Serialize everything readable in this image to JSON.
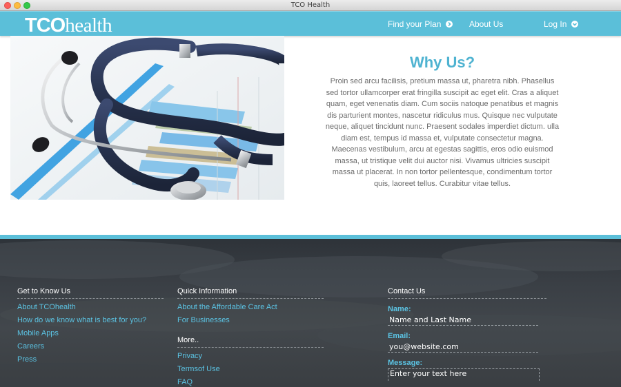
{
  "window": {
    "title": "TCO Health"
  },
  "header": {
    "logo_bold": "TCO",
    "logo_light": "health",
    "nav": {
      "find_plan": "Find your Plan",
      "about": "About Us",
      "login": "Log In"
    },
    "icons": {
      "find_plan": "chevron-right-circle-icon",
      "login": "chevron-down-circle-icon"
    },
    "color": "#5bbfd9"
  },
  "hero": {
    "image": "stethoscope-on-chart-photo"
  },
  "why_us": {
    "title": "Why Us?",
    "body": "Proin sed arcu facilisis, pretium massa ut, pharetra nibh. Phasellus sed tortor ullamcorper erat fringilla suscipit ac eget elit. Cras a aliquet quam, eget venenatis diam. Cum sociis natoque penatibus et magnis dis parturient montes, nascetur ridiculus mus. Quisque nec vulputate neque, aliquet tincidunt nunc. Praesent sodales imperdiet dictum. ulla diam est, tempus id massa et, vulputate consectetur magna. Maecenas vestibulum, arcu at egestas sagittis, eros odio euismod massa, ut tristique velit dui auctor nisi. Vivamus ultricies suscipit massa ut placerat. In non tortor pellentesque, condimentum tortor quis, laoreet tellus. Curabitur vitae tellus."
  },
  "footer": {
    "get_to_know": {
      "heading": "Get to Know Us",
      "links": [
        "About TCOhealth",
        "How do we know what is best for you?",
        "Mobile Apps",
        "Careers",
        "Press"
      ]
    },
    "quick_info": {
      "heading": "Quick Information",
      "links": [
        "About the Affordable Care Act",
        "For Businesses"
      ]
    },
    "more": {
      "heading": "More..",
      "links": [
        "Privacy",
        "Termsof Use",
        "FAQ"
      ]
    },
    "contact": {
      "heading": "Contact Us",
      "name_label": "Name:",
      "name_placeholder": "Name and Last Name",
      "email_label": "Email:",
      "email_placeholder": "you@website.com",
      "message_label": "Message:",
      "message_placeholder": "Enter your text here"
    },
    "accent_color": "#5bc3e3"
  }
}
